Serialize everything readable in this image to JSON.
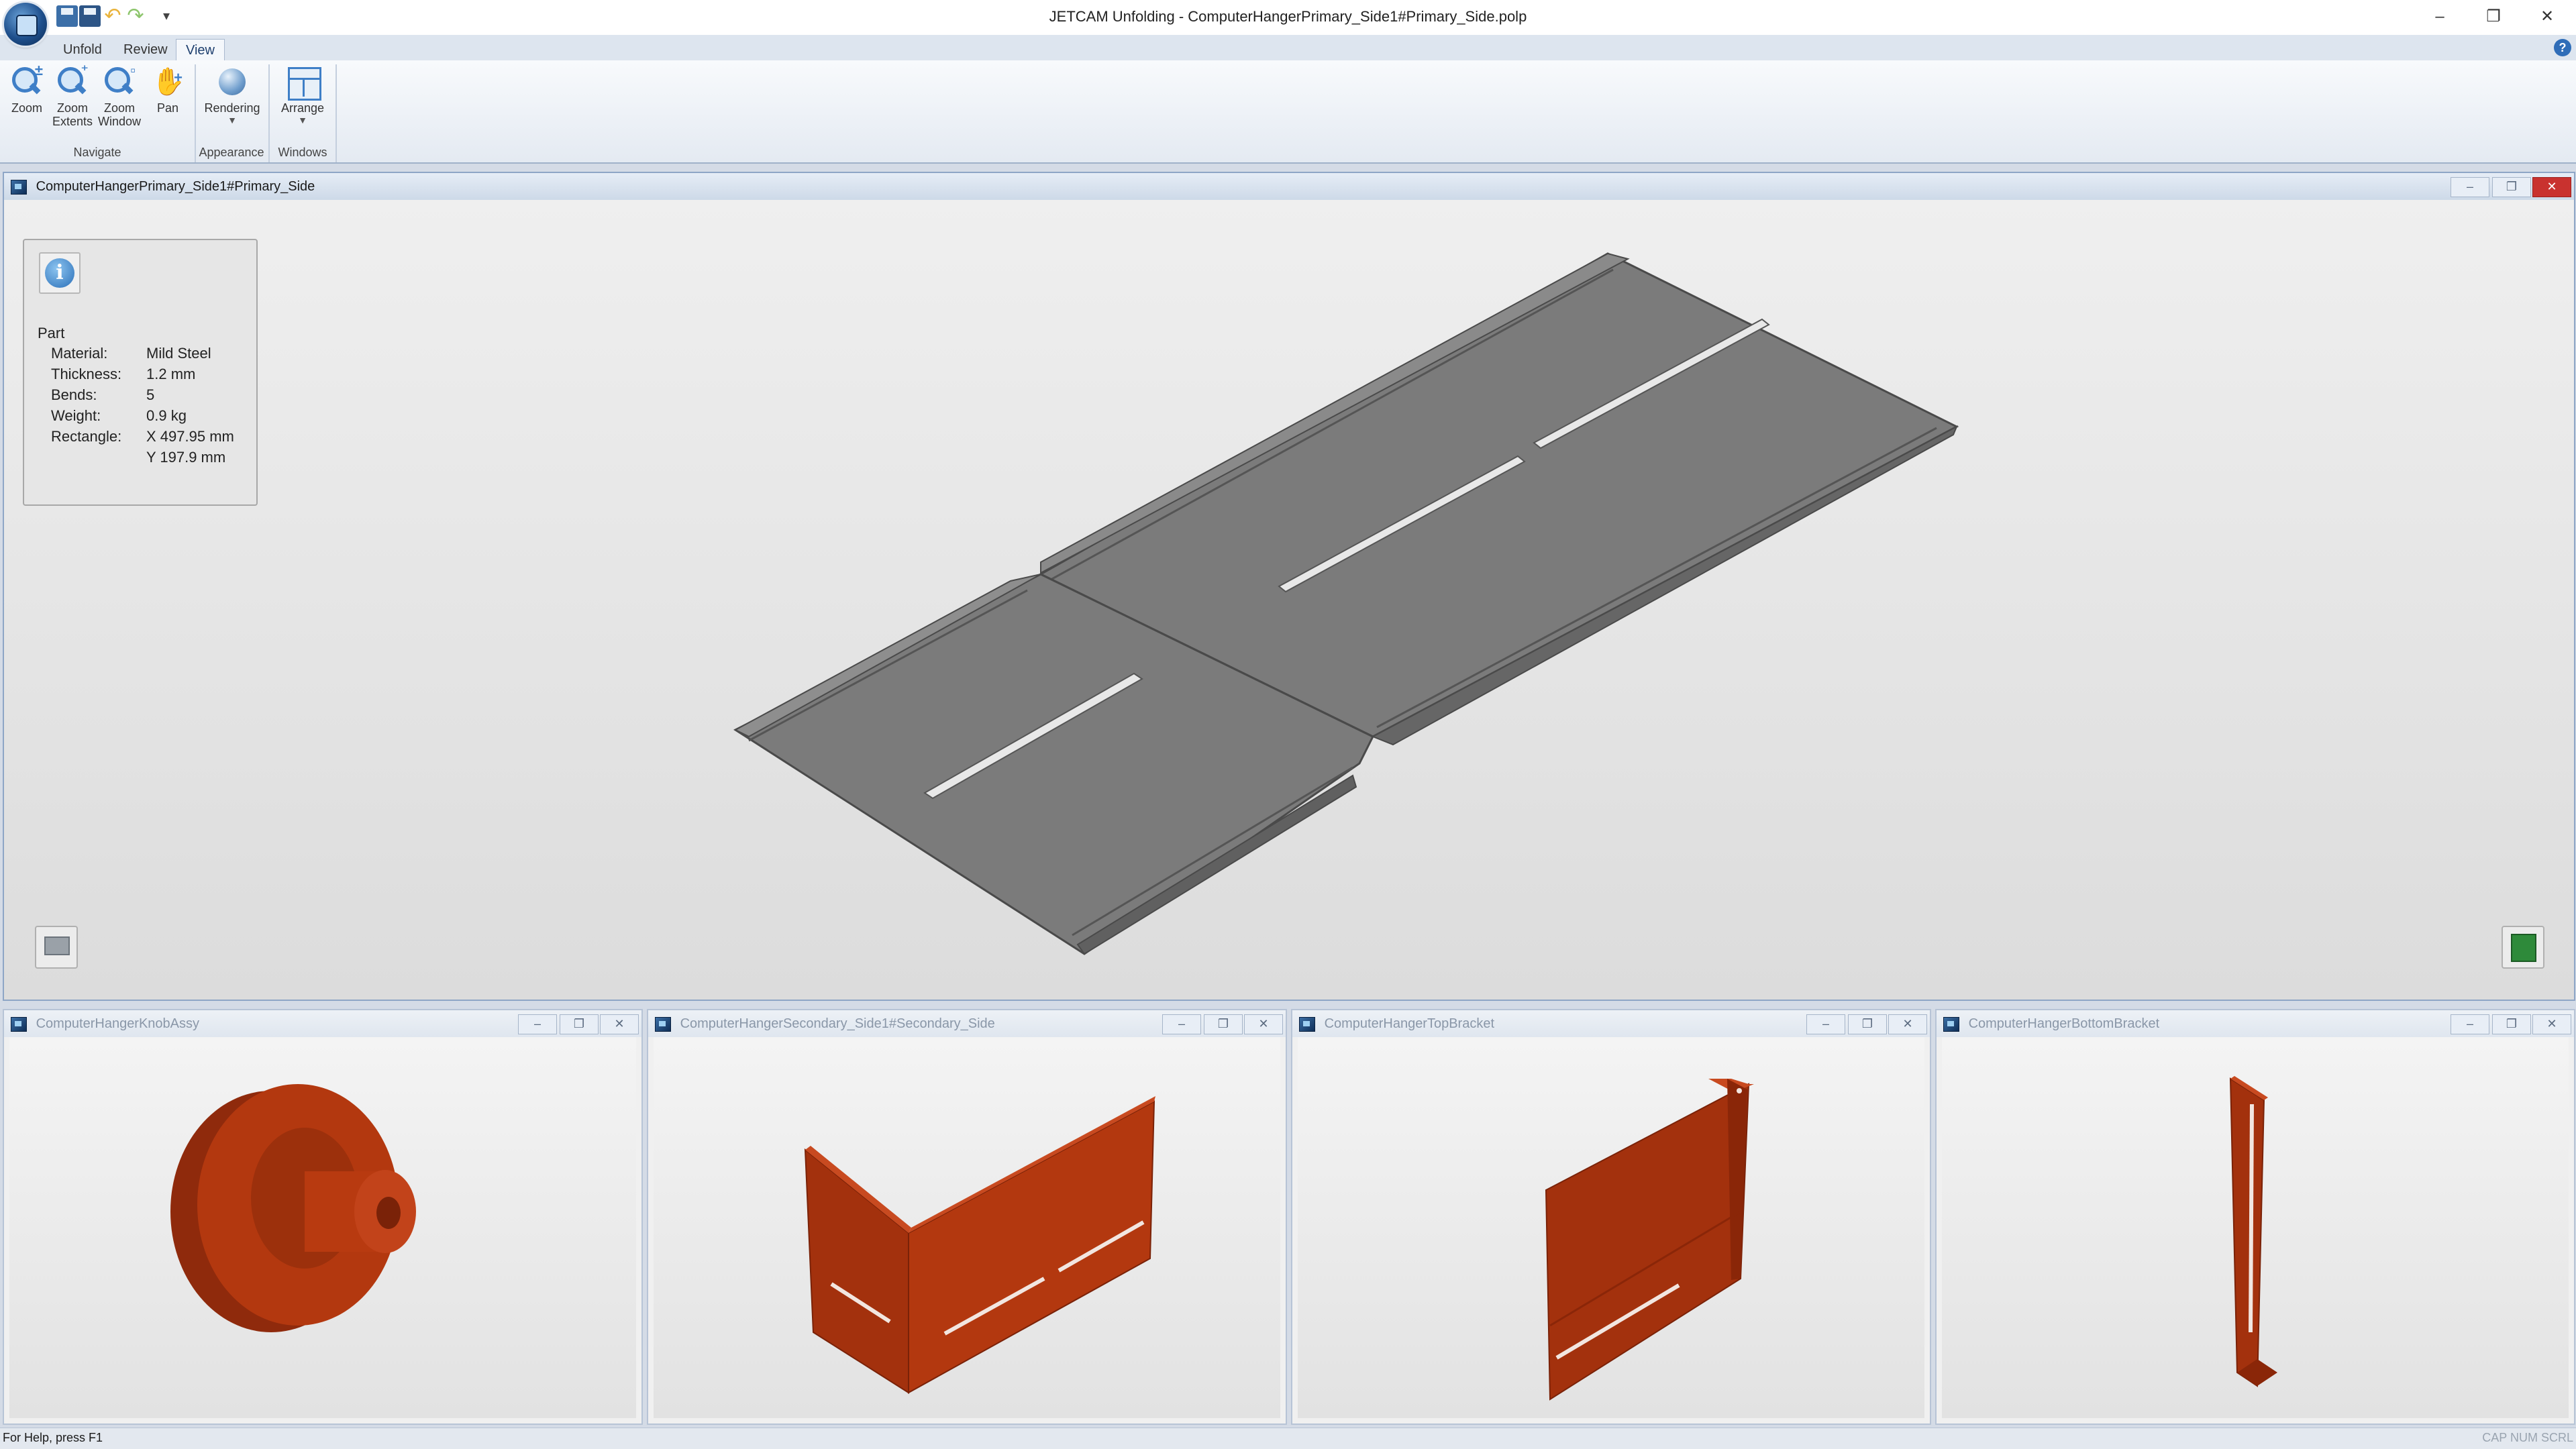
{
  "window": {
    "title": "JETCAM Unfolding - ComputerHangerPrimary_Side1#Primary_Side.polp",
    "controls": {
      "minimize": "–",
      "restore": "❐",
      "close": "✕"
    }
  },
  "quick_access": {
    "menu_glyph": "▾"
  },
  "ribbon": {
    "tabs": [
      "Unfold",
      "Review",
      "View"
    ],
    "active_tab": "View",
    "help_glyph": "?",
    "groups": {
      "navigate": {
        "label": "Navigate",
        "buttons": [
          {
            "line1": "Zoom",
            "line2": ""
          },
          {
            "line1": "Zoom",
            "line2": "Extents"
          },
          {
            "line1": "Zoom",
            "line2": "Window"
          },
          {
            "line1": "Pan",
            "line2": ""
          }
        ]
      },
      "appearance": {
        "label": "Appearance",
        "button": "Rendering"
      },
      "windows": {
        "label": "Windows",
        "button": "Arrange"
      }
    }
  },
  "main_window": {
    "title": "ComputerHangerPrimary_Side1#Primary_Side",
    "info": {
      "heading": "Part",
      "rows": [
        {
          "key": "Material:",
          "value": "Mild Steel"
        },
        {
          "key": "Thickness:",
          "value": "1.2 mm"
        },
        {
          "key": "Bends:",
          "value": "5"
        },
        {
          "key": "Weight:",
          "value": "0.9 kg"
        },
        {
          "key": "Rectangle:",
          "value": "X 497.95 mm"
        },
        {
          "key": "",
          "value": "Y 197.9 mm"
        }
      ]
    },
    "part_color": "#7b7b7b"
  },
  "sub_windows": [
    {
      "title": "ComputerHangerKnobAssy"
    },
    {
      "title": "ComputerHangerSecondary_Side1#Secondary_Side"
    },
    {
      "title": "ComputerHangerTopBracket"
    },
    {
      "title": "ComputerHangerBottomBracket"
    }
  ],
  "sub_window_controls": {
    "minimize": "–",
    "restore": "❐",
    "close": "✕"
  },
  "model_color": "#b03510",
  "statusbar": {
    "help_text": "For Help, press F1",
    "keys": "CAP NUM SCRL"
  }
}
